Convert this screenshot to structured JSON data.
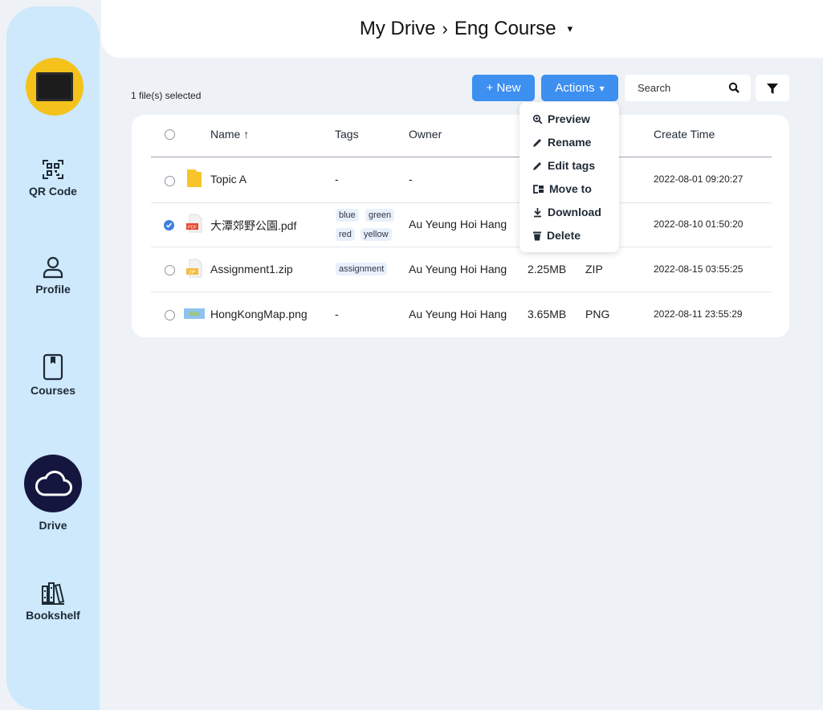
{
  "sidebar": {
    "items": [
      {
        "label": "QR Code"
      },
      {
        "label": "Profile"
      },
      {
        "label": "Courses"
      },
      {
        "label": "Drive"
      },
      {
        "label": "Bookshelf"
      }
    ],
    "active": "Drive"
  },
  "header": {
    "root": "My Drive",
    "separator": "›",
    "current": "Eng Course",
    "caret": "▾"
  },
  "toolbar": {
    "selected_count": "1 file(s) selected",
    "new_label": "+ New",
    "actions_label": "Actions",
    "actions_caret": "▾",
    "search_placeholder": "Search"
  },
  "actions_menu": [
    {
      "label": "Preview",
      "icon": "zoom-icon"
    },
    {
      "label": "Rename",
      "icon": "pencil-icon"
    },
    {
      "label": "Edit tags",
      "icon": "pencil-icon"
    },
    {
      "label": "Move to",
      "icon": "move-icon"
    },
    {
      "label": "Download",
      "icon": "download-icon"
    },
    {
      "label": "Delete",
      "icon": "trash-icon"
    }
  ],
  "table": {
    "columns": [
      "Name ↑",
      "Tags",
      "Owner",
      "Create Time"
    ],
    "rows": [
      {
        "name": "Topic A",
        "type_icon": "folder-icon",
        "selected": false,
        "tags": [
          "-"
        ],
        "owner": "-",
        "size": "",
        "type": "",
        "created": "2022-08-01 09:20:27"
      },
      {
        "name": "大潭郊野公園.pdf",
        "type_icon": "pdf-icon",
        "selected": true,
        "tags": [
          "blue",
          "green",
          "red",
          "yellow"
        ],
        "owner": "Au Yeung Hoi Hang",
        "size": "",
        "type": "",
        "created": "2022-08-10 01:50:20"
      },
      {
        "name": "Assignment1.zip",
        "type_icon": "zip-icon",
        "selected": false,
        "tags": [
          "assignment"
        ],
        "owner": "Au Yeung Hoi Hang",
        "size": "2.25MB",
        "type": "ZIP",
        "created": "2022-08-15 03:55:25"
      },
      {
        "name": "HongKongMap.png",
        "type_icon": "image-icon",
        "selected": false,
        "tags": [
          "-"
        ],
        "owner": "Au Yeung Hoi Hang",
        "size": "3.65MB",
        "type": "PNG",
        "created": "2022-08-11 23:55:29"
      }
    ]
  },
  "colors": {
    "accent": "#3d8ff0",
    "sidebar": "#cde9fb",
    "logo": "#f4c21b",
    "drive_active": "#14163f"
  }
}
